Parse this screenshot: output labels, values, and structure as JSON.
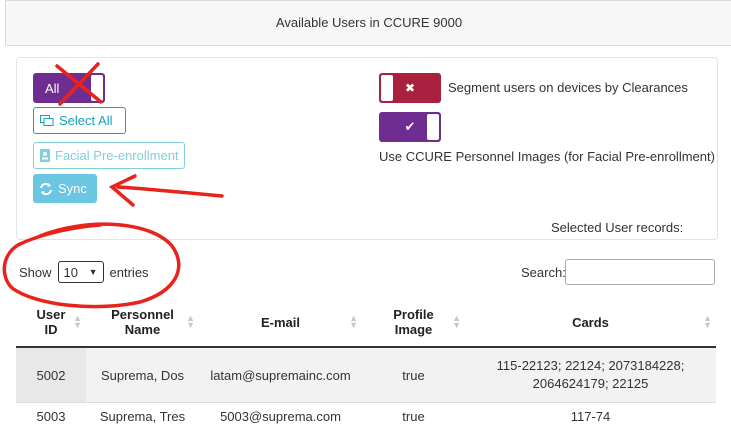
{
  "header": {
    "title": "Available Users in CCURE 9000"
  },
  "controls": {
    "all_toggle_label": "All",
    "select_all_label": "Select All",
    "facial_preenroll_label": "Facial Pre-enrollment",
    "sync_label": "Sync",
    "segment_toggle_glyph": "✖",
    "segment_label": "Segment users on devices by Clearances",
    "images_toggle_glyph": "✔",
    "images_label": "Use CCURE Personnel Images (for Facial Pre-enrollment)",
    "selected_records_label": "Selected User records:"
  },
  "length_menu": {
    "show": "Show",
    "value": "10",
    "entries": "entries"
  },
  "search": {
    "label": "Search:",
    "value": ""
  },
  "table": {
    "columns": [
      "User ID",
      "Personnel Name",
      "E-mail",
      "Profile Image",
      "Cards"
    ],
    "rows": [
      [
        "5002",
        "Suprema, Dos",
        "latam@supremainc.com",
        "true",
        "115-22123; 22124; 2073184228; 2064624179; 22125"
      ],
      [
        "5003",
        "Suprema, Tres",
        "5003@suprema.com",
        "true",
        "117-74"
      ]
    ]
  },
  "annotation_colors": {
    "markup": "#e8231b"
  },
  "colors": {
    "purple": "#6f2c91",
    "crimson": "#a8223f",
    "info": "#17a2b8",
    "sync": "#5bc0de"
  }
}
